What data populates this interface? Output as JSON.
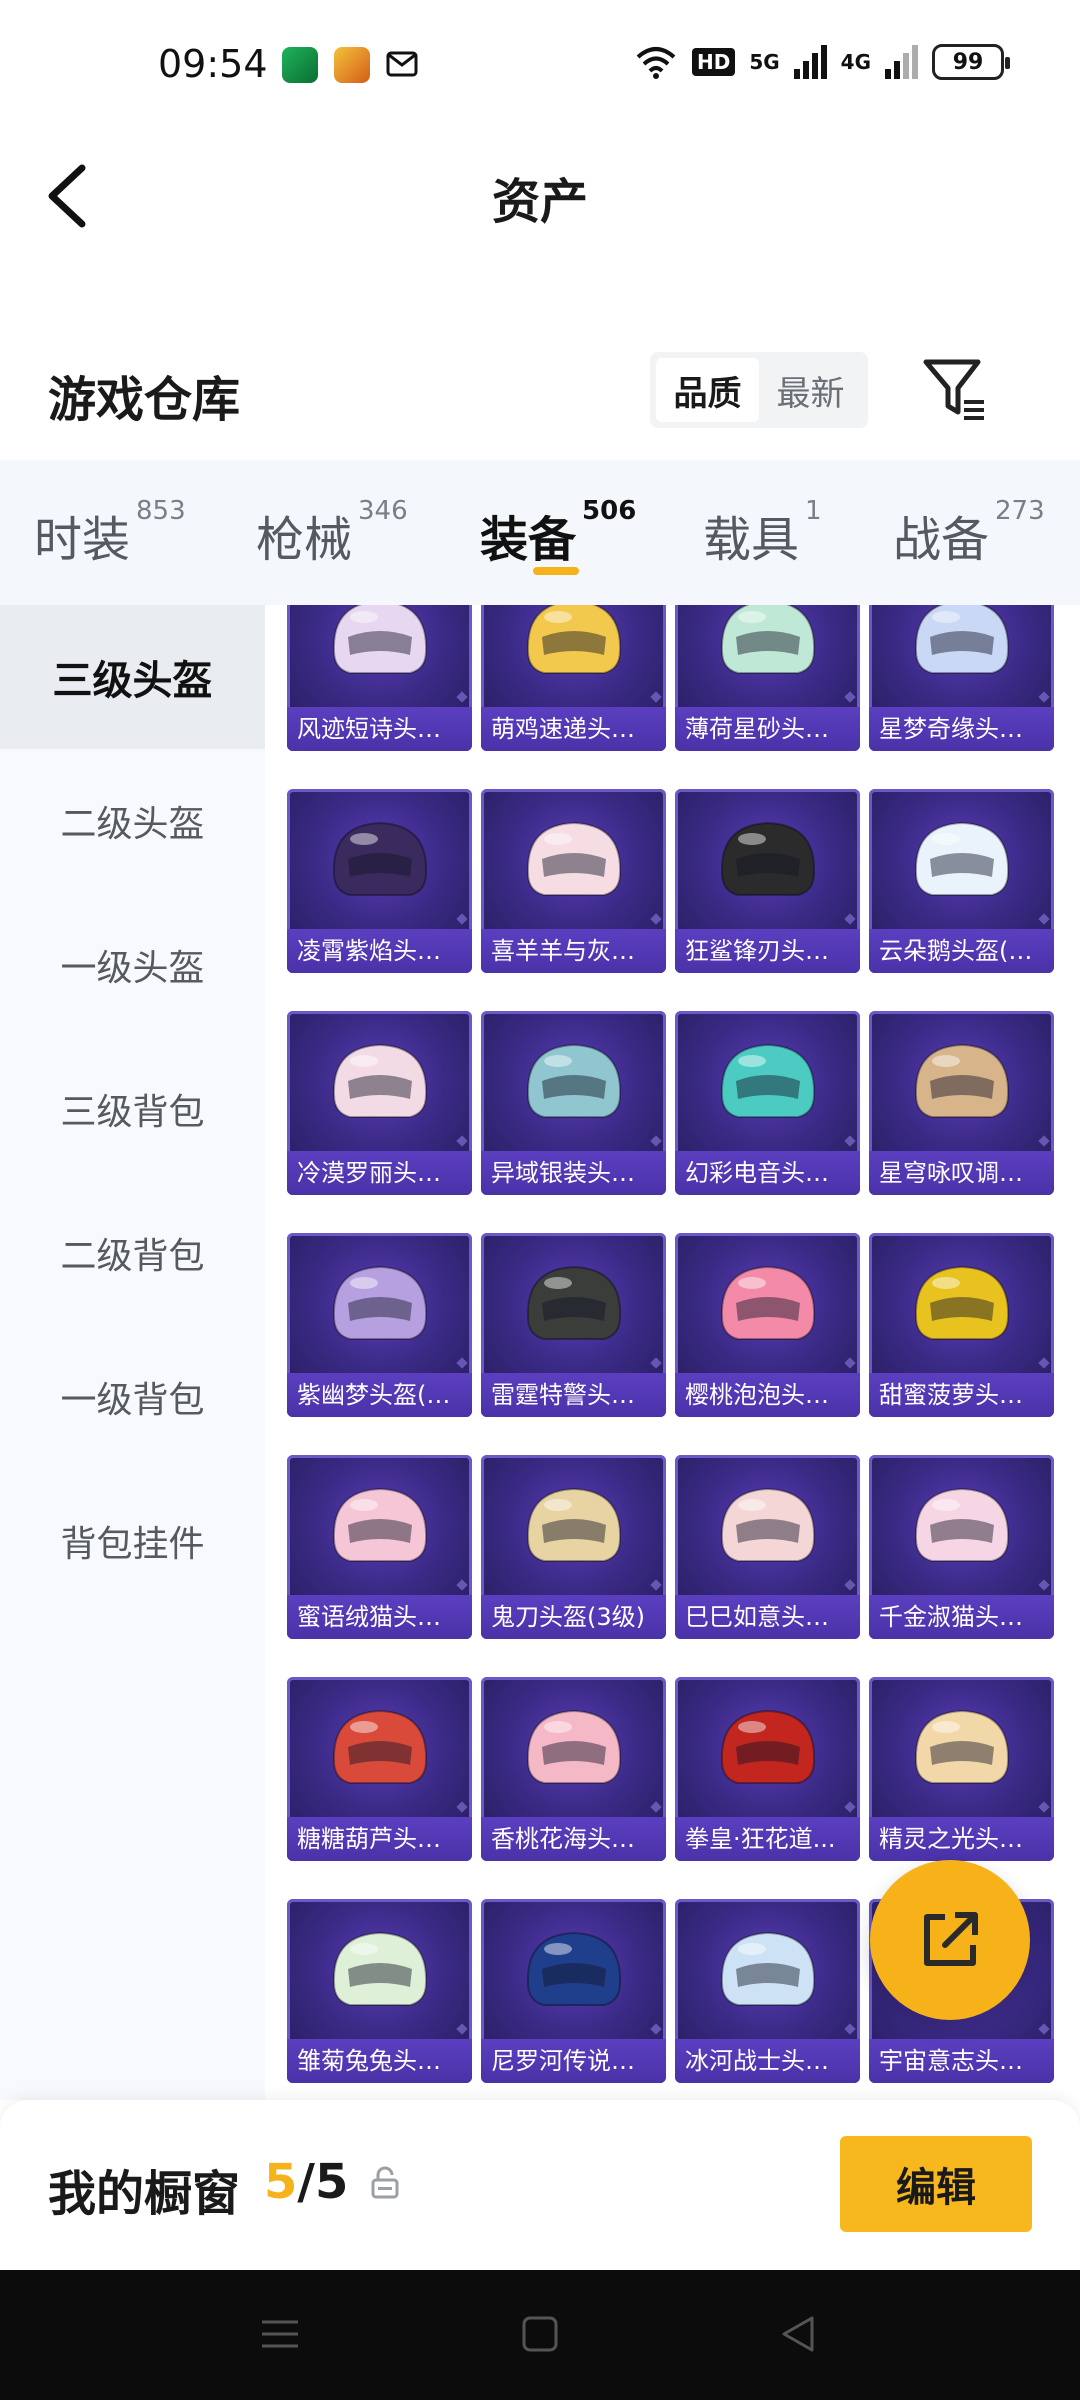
{
  "status": {
    "time": "09:54",
    "network_hd": "HD",
    "net_5g": "5G",
    "net_4g": "4G",
    "battery": "99"
  },
  "header": {
    "title": "资产"
  },
  "section": {
    "title": "游戏仓库",
    "sort_options": [
      "品质",
      "最新"
    ],
    "sort_selected": "品质"
  },
  "tabs": [
    {
      "label": "时装",
      "count": "853"
    },
    {
      "label": "枪械",
      "count": "346"
    },
    {
      "label": "装备",
      "count": "506"
    },
    {
      "label": "载具",
      "count": "1"
    },
    {
      "label": "战备",
      "count": "273"
    }
  ],
  "active_tab": "装备",
  "sidebar": {
    "items": [
      {
        "label": "三级头盔"
      },
      {
        "label": "二级头盔"
      },
      {
        "label": "一级头盔"
      },
      {
        "label": "三级背包"
      },
      {
        "label": "二级背包"
      },
      {
        "label": "一级背包"
      },
      {
        "label": "背包挂件"
      }
    ],
    "active": "三级头盔"
  },
  "items": [
    {
      "name": "风迹短诗头盔...",
      "color": "#e8d7f0"
    },
    {
      "name": "萌鸡速递头盔...",
      "color": "#f2c94c"
    },
    {
      "name": "薄荷星砂头盔...",
      "color": "#bfe9d6"
    },
    {
      "name": "星梦奇缘头盔...",
      "color": "#c9d8f5"
    },
    {
      "name": "凌霄紫焰头盔...",
      "color": "#3b2a5e"
    },
    {
      "name": "喜羊羊与灰太...",
      "color": "#f5dde3"
    },
    {
      "name": "狂鲨锋刃头盔...",
      "color": "#2b2b2b"
    },
    {
      "name": "云朵鹅头盔(3...",
      "color": "#eaf3fb"
    },
    {
      "name": "冷漠罗丽头盔...",
      "color": "#f3dbe5"
    },
    {
      "name": "异域银装头盔...",
      "color": "#8fc6cf"
    },
    {
      "name": "幻彩电音头盔...",
      "color": "#4ccbc3"
    },
    {
      "name": "星穹咏叹调头...",
      "color": "#d8b48a"
    },
    {
      "name": "紫幽梦头盔(3...",
      "color": "#b7a0e0"
    },
    {
      "name": "雷霆特警头盔...",
      "color": "#3a3d3a"
    },
    {
      "name": "樱桃泡泡头盔...",
      "color": "#f28aa8"
    },
    {
      "name": "甜蜜菠萝头盔...",
      "color": "#e8c320"
    },
    {
      "name": "蜜语绒猫头盔...",
      "color": "#f4c6d6"
    },
    {
      "name": "鬼刀头盔(3级)",
      "color": "#e8d3a3"
    },
    {
      "name": "巳巳如意头盔...",
      "color": "#f4d6d6"
    },
    {
      "name": "千金淑猫头盔...",
      "color": "#f6d5e4"
    },
    {
      "name": "糖糖葫芦头盔...",
      "color": "#d94a3a"
    },
    {
      "name": "香桃花海头盔...",
      "color": "#f5b8c6"
    },
    {
      "name": "拳皇·狂花道...",
      "color": "#c2261f"
    },
    {
      "name": "精灵之光头盔...",
      "color": "#f2d7a8"
    },
    {
      "name": "雏菊兔兔头盔...",
      "color": "#dff0d8"
    },
    {
      "name": "尼罗河传说头...",
      "color": "#1f3f8c"
    },
    {
      "name": "冰河战士头盔...",
      "color": "#cde3f5"
    },
    {
      "name": "宇宙意志头盔...",
      "color": "#8a7ae0"
    }
  ],
  "showcase": {
    "label": "我的橱窗",
    "current": "5",
    "separator": "/",
    "total": "5",
    "edit_label": "编辑"
  },
  "colors": {
    "accent": "#f7b81d",
    "tab_bg": "#f4f7fb",
    "card_bg": "#3a2a85"
  }
}
